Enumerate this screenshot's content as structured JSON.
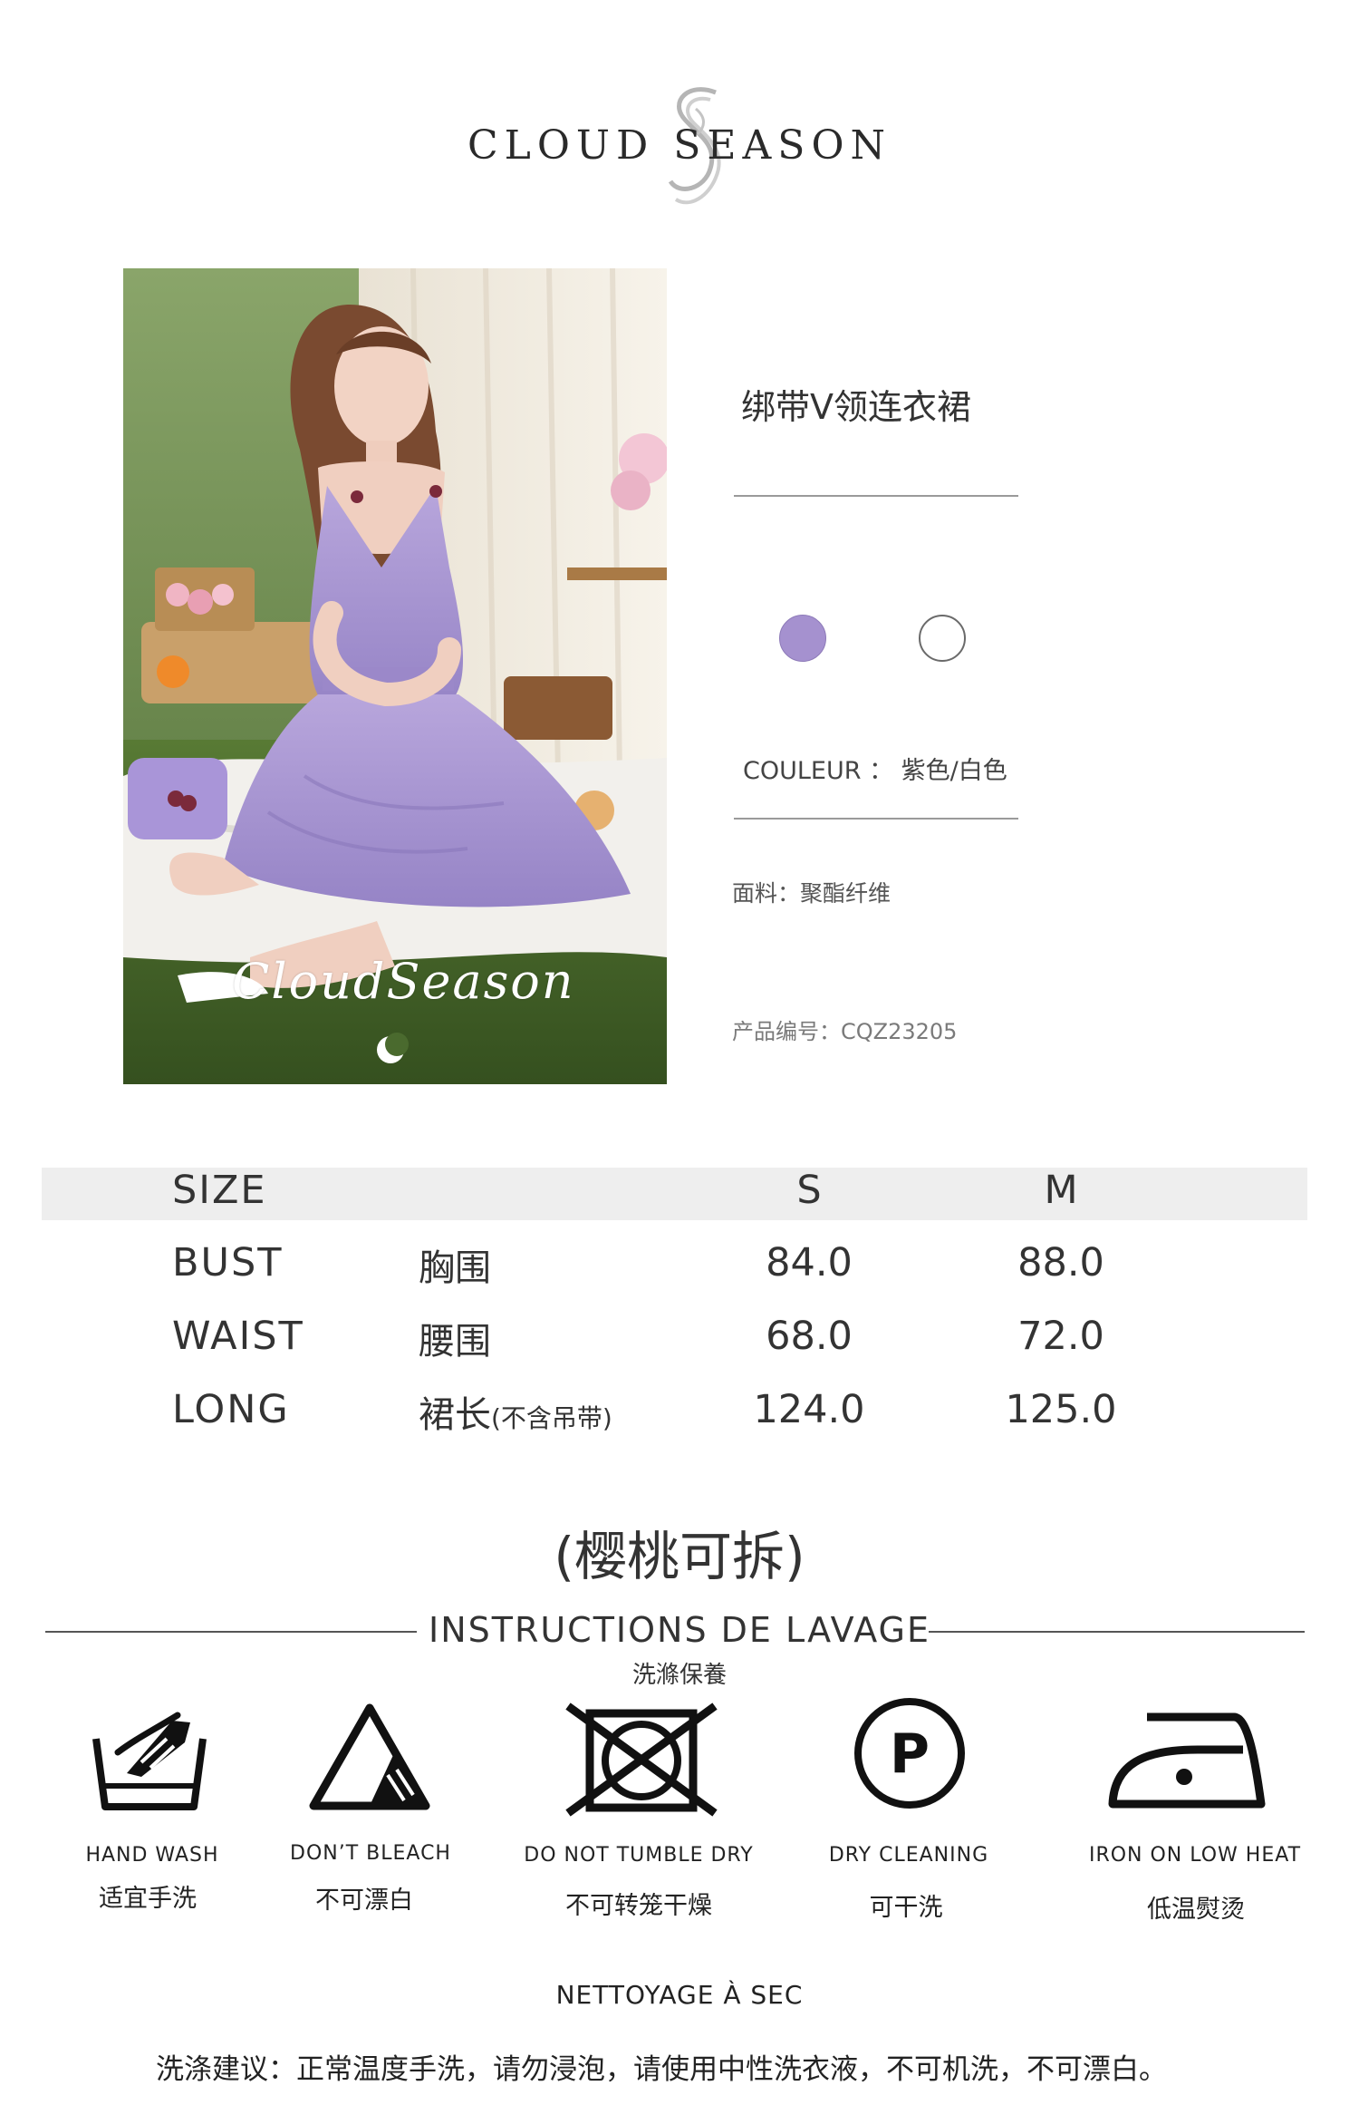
{
  "brand": {
    "name": "CLOUD SEASON"
  },
  "photo": {
    "signature": "CloudSeason"
  },
  "product": {
    "name": "绑带V领连衣裙",
    "colors": [
      {
        "name": "紫色",
        "hex": "#a591cf"
      },
      {
        "name": "白色",
        "hex": "#ffffff"
      }
    ],
    "couleur": "COULEUR ：  紫色/白色",
    "fabric": "面料：聚酯纤维",
    "product_no": "产品编号：CQZ23205"
  },
  "size_table": {
    "header": {
      "label": "SIZE",
      "s": "S",
      "m": "M"
    },
    "rows": [
      {
        "en": "BUST",
        "cn": "胸围",
        "note": "",
        "s": "84.0",
        "m": "88.0"
      },
      {
        "en": "WAIST",
        "cn": "腰围",
        "note": "",
        "s": "68.0",
        "m": "72.0"
      },
      {
        "en": "LONG",
        "cn": "裙长",
        "note": "(不含吊带)",
        "s": "124.0",
        "m": "125.0"
      }
    ]
  },
  "note": "(樱桃可拆)",
  "washing": {
    "title": "INSTRUCTIONS DE LAVAGE",
    "subtitle": "洗滌保養",
    "items": [
      {
        "icon": "hand-wash-icon",
        "en": "HAND WASH",
        "cn": "适宜手洗"
      },
      {
        "icon": "no-bleach-icon",
        "en": "DON’T BLEACH",
        "cn": "不可漂白"
      },
      {
        "icon": "no-tumble-dry-icon",
        "en": "DO NOT TUMBLE DRY",
        "cn": "不可转笼干燥"
      },
      {
        "icon": "dry-clean-icon",
        "en": "DRY CLEANING",
        "cn": "可干洗"
      },
      {
        "icon": "iron-low-icon",
        "en": "IRON ON LOW HEAT",
        "cn": "低温熨烫"
      }
    ],
    "nettoyage": "NETTOYAGE À SEC",
    "advice": "洗涤建议：正常温度手洗，请勿浸泡，请使用中性洗衣液，不可机洗，不可漂白。"
  }
}
